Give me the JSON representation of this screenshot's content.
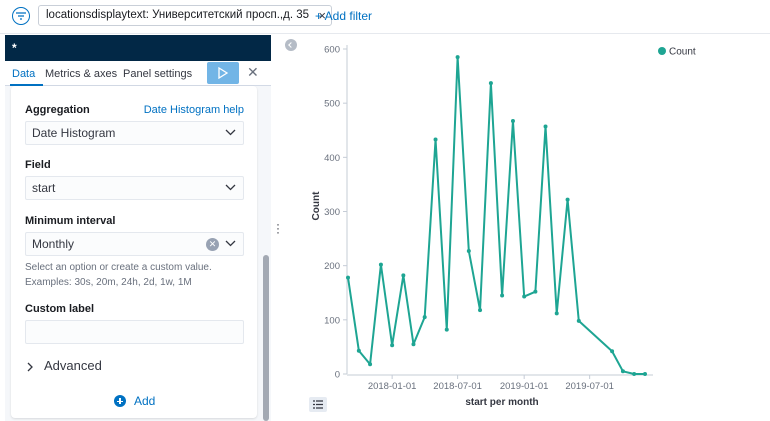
{
  "filter_bar": {
    "pill_label": "locationsdisplaytext: Университетский просп.,д. 35",
    "add_filter_label": "+ Add filter"
  },
  "sidebar": {
    "title": "*",
    "tabs": [
      {
        "label": "Data"
      },
      {
        "label": "Metrics & axes"
      },
      {
        "label": "Panel settings"
      }
    ],
    "aggregation_label": "Aggregation",
    "aggregation_help": "Date Histogram help",
    "aggregation_value": "Date Histogram",
    "field_label": "Field",
    "field_value": "start",
    "interval_label": "Minimum interval",
    "interval_value": "Monthly",
    "interval_help_1": "Select an option or create a custom value.",
    "interval_help_2": "Examples: 30s, 20m, 24h, 2d, 1w, 1M",
    "custom_label_label": "Custom label",
    "custom_label_value": "",
    "advanced_label": "Advanced",
    "add_label": "Add"
  },
  "colors": {
    "accent": "#0071c2",
    "series": "#1ea593",
    "header_bg": "#022846"
  },
  "chart_data": {
    "type": "line",
    "xlabel": "start per month",
    "ylabel": "Count",
    "ylim": [
      0,
      600
    ],
    "yticks": [
      "0",
      "100",
      "200",
      "300",
      "400",
      "500",
      "600"
    ],
    "xticks": [
      "2018-01-01",
      "2018-07-01",
      "2019-01-01",
      "2019-07-01"
    ],
    "legend_position": "top-right",
    "series": [
      {
        "name": "Count",
        "color": "#1ea593",
        "x": [
          "2017-09-01",
          "2017-10-01",
          "2017-11-01",
          "2017-12-01",
          "2018-01-01",
          "2018-02-01",
          "2018-03-01",
          "2018-04-01",
          "2018-05-01",
          "2018-06-01",
          "2018-07-01",
          "2018-08-01",
          "2018-09-01",
          "2018-10-01",
          "2018-11-01",
          "2018-12-01",
          "2019-01-01",
          "2019-02-01",
          "2019-03-01",
          "2019-04-01",
          "2019-05-01",
          "2019-06-01",
          "2019-09-01",
          "2019-10-01",
          "2019-11-01",
          "2019-12-01"
        ],
        "values": [
          178,
          43,
          18,
          202,
          53,
          182,
          55,
          105,
          433,
          82,
          585,
          227,
          118,
          537,
          145,
          467,
          143,
          152,
          457,
          112,
          322,
          98,
          42,
          5,
          0,
          0
        ]
      }
    ]
  }
}
